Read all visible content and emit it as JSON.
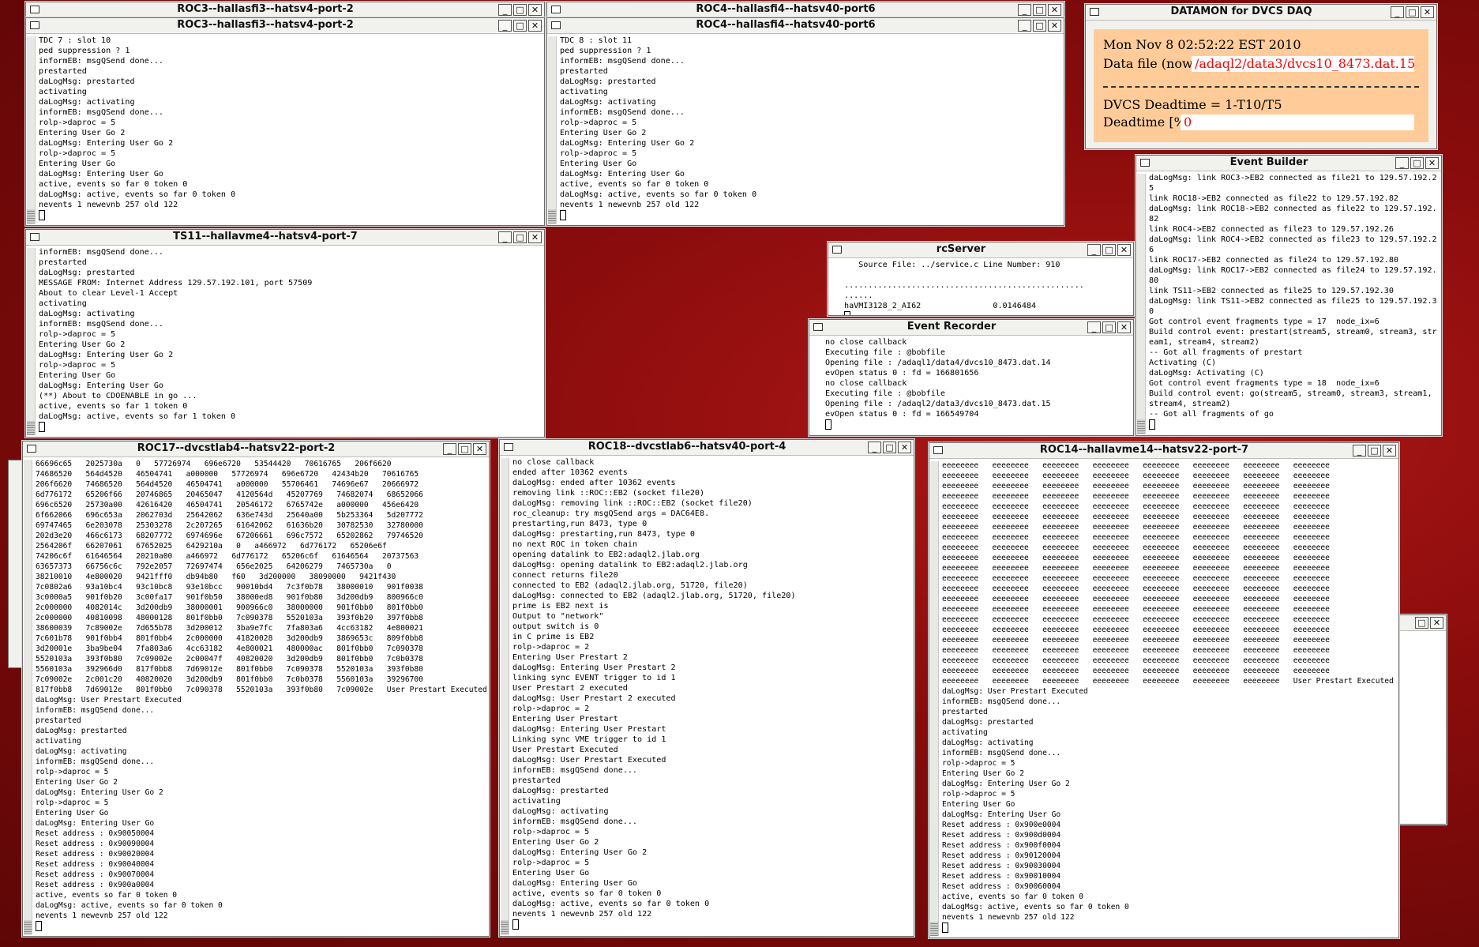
{
  "windows": {
    "roc3_back": {
      "title": "ROC3--hallasfi3--hatsv4-port-2"
    },
    "roc4_back": {
      "title": "ROC4--hallasfi4--hatsv40-port6"
    },
    "roc3": {
      "title": "ROC3--hallasfi3--hatsv4-port-2",
      "text": "TDC 7 : slot 10\nped suppression ? 1\ninformEB: msgQSend done...\nprestarted\ndaLogMsg: prestarted\nactivating\ndaLogMsg: activating\ninformEB: msgQSend done...\nrolp->daproc = 5\nEntering User Go 2\ndaLogMsg: Entering User Go 2\nrolp->daproc = 5\nEntering User Go\ndaLogMsg: Entering User Go\nactive, events so far 0 token 0\ndaLogMsg: active, events so far 0 token 0\nnevents 1 newevnb 257 old 122"
    },
    "roc4": {
      "title": "ROC4--hallasfi4--hatsv40-port6",
      "text": "TDC 8 : slot 11\nped suppression ? 1\ninformEB: msgQSend done...\nprestarted\ndaLogMsg: prestarted\nactivating\ndaLogMsg: activating\ninformEB: msgQSend done...\nrolp->daproc = 5\nEntering User Go 2\ndaLogMsg: Entering User Go 2\nrolp->daproc = 5\nEntering User Go\ndaLogMsg: Entering User Go\nactive, events so far 0 token 0\ndaLogMsg: active, events so far 0 token 0\nnevents 1 newevnb 257 old 122"
    },
    "ts11": {
      "title": "TS11--hallavme4--hatsv4-port-7",
      "text": "informEB: msgQSend done...\nprestarted\ndaLogMsg: prestarted\nMESSAGE FROM: Internet Address 129.57.192.101, port 57509\nAbout to clear Level-1 Accept\nactivating\ndaLogMsg: activating\ninformEB: msgQSend done...\nrolp->daproc = 5\nEntering User Go 2\ndaLogMsg: Entering User Go 2\nrolp->daproc = 5\nEntering User Go\ndaLogMsg: Entering User Go\n(**) About to CDOENABLE in go ...\nactive, events so far 1 token 0\ndaLogMsg: active, events so far 1 token 0"
    },
    "datamon": {
      "title": "DATAMON  for DVCS DAQ",
      "date": "Mon Nov  8 02:52:22 EST 2010",
      "datafile_label": "Data file (now)",
      "datafile_value": "/adaql2/data3/dvcs10_8473.dat.15",
      "deadtime_formula": "DVCS Deadtime = 1-T10/T5",
      "deadtime_label": "Deadtime [%]:",
      "deadtime_value": "0"
    },
    "event_builder": {
      "title": "Event Builder",
      "text": "daLogMsg: link ROC3->EB2 connected as file21 to 129.57.192.2\n5\nlink ROC18->EB2 connected as file22 to 129.57.192.82\ndaLogMsg: link ROC18->EB2 connected as file22 to 129.57.192.\n82\nlink ROC4->EB2 connected as file23 to 129.57.192.26\ndaLogMsg: link ROC4->EB2 connected as file23 to 129.57.192.2\n6\nlink ROC17->EB2 connected as file24 to 129.57.192.80\ndaLogMsg: link ROC17->EB2 connected as file24 to 129.57.192.\n80\nlink TS11->EB2 connected as file25 to 129.57.192.30\ndaLogMsg: link TS11->EB2 connected as file25 to 129.57.192.3\n0\nGot control event fragments type = 17  node_ix=6\nBuild control event: prestart(stream5, stream0, stream3, str\neam1, stream4, stream2)\n-- Got all fragments of prestart\nActivating (C)\ndaLogMsg: Activating (C)\nGot control event fragments type = 18  node_ix=6\nBuild control event: go(stream5, stream0, stream3, stream1,\nstream4, stream2)\n-- Got all fragments of go"
    },
    "rcserver": {
      "title": "rcServer",
      "text": "   Source File: ../service.c Line Number: 910\n\n..................................................\n......\nhaVMI3128_2_AI62               0.0146484"
    },
    "event_recorder": {
      "title": "Event Recorder",
      "text": "no close callback\nExecuting file : @bobfile\nOpening file : /adaql1/data4/dvcs10_8473.dat.14\nevOpen status 0 : fd = 166801656\nno close callback\nExecuting file : @bobfile\nOpening file : /adaql2/data3/dvcs10_8473.dat.15\nevOpen status 0 : fd = 166549704"
    },
    "roc17": {
      "title": "ROC17--dvcstlab4--hatsv22-port-2",
      "text": "66696c65   2025730a   0   57726974   696e6720   53544420   70616765   206f6620\n74686520   564d4520   46504741   a000000   57726974   696e6720   42434b20   70616765\n206f6620   74686520   564d4520   46504741   a000000   55706461   74696e67   20666972\n6d776172   65206f66   20746865   20465047   4120564d   45207769   74682074   68652066\n696c6520   25730a00   42616420   46504741   20546172   6765742e   a000000   456e6420\n6f662066   696c653a   2062703d   25642062   636e743d   25640a00   5b253364   5d207772\n69747465   6e203078   25303278   2c207265   61642062   61636b20   30782530   32780000\n202d3e20   466c6173   68207772   6974696e   67206661   696c7572   65202862   79746520\n2564206f   66207061   67652025   6429210a   0   a466972   6d776172   65206e6f\n74206c6f   61646564   20210a00   a466972   6d776172   65206c6f   61646564   20737563\n63657373   66756c6c   792e2057   72697474   656e2025   64206279   7465730a   0\n38210010   4e800020   9421fff0   db94b80   f60   3d200000   38090000   9421f430\n7c0802a6   93a10bc4   93c10bc8   93e10bcc   90010bd4   7c3f0b78   38000010   901f0038\n3c0000a5   901f0b20   3c00fa17   901f0b50   38000ed8   901f0b80   3d200db9   800966c0\n2c000000   4082014c   3d200db9   38000001   900966c0   38000000   901f0bb0   801f0bb0\n2c000000   40810098   48000128   801f0bb0   7c090378   5520103a   393f0b20   397f0bb8\n38600039   7c89002e   7d655b78   3d200012   3ba9e7fc   7fa803a6   4cc63182   4e800021\n7c601b78   901f0bb4   801f0bb4   2c000000   41820028   3d200db9   3869653c   809f0bb8\n3d20001e   3ba9be04   7fa803a6   4cc63182   4e800021   480000ac   801f0bb0   7c090378\n5520103a   393f0b80   7c09002e   2c00047f   40820020   3d200db9   801f0bb0   7c0b0378\n5560103a   392966d0   817f0bb8   7d69012e   801f0bb0   7c090378   5520103a   393f0b80\n7c09002e   2c001c20   40820020   3d200db9   801f0bb0   7c0b0378   5560103a   39296700\n817f0bb8   7d69012e   801f0bb0   7c090378   5520103a   393f0b80   7c09002e   User Prestart Executed\ndaLogMsg: User Prestart Executed\ninformEB: msgQSend done...\nprestarted\ndaLogMsg: prestarted\nactivating\ndaLogMsg: activating\ninformEB: msgQSend done...\nrolp->daproc = 5\nEntering User Go 2\ndaLogMsg: Entering User Go 2\nrolp->daproc = 5\nEntering User Go\ndaLogMsg: Entering User Go\nReset address : 0x90050004\nReset address : 0x90090004\nReset address : 0x90020004\nReset address : 0x90040004\nReset address : 0x90070004\nReset address : 0x900a0004\nactive, events so far 0 token 0\ndaLogMsg: active, events so far 0 token 0\nnevents 1 newevnb 257 old 122"
    },
    "roc18": {
      "title": "ROC18--dvcstlab6--hatsv40-port-4",
      "text": "no close callback\nended after 10362 events\ndaLogMsg: ended after 10362 events\nremoving link ::ROC::EB2 (socket file20)\ndaLogMsg: removing link ::ROC::EB2 (socket file20)\nroc_cleanup: try msgQSend args = DAC64E8.\nprestarting,run 8473, type 0\ndaLogMsg: prestarting,run 8473, type 0\nno next ROC in token chain\nopening datalink to EB2:adaql2.jlab.org\ndaLogMsg: opening datalink to EB2:adaql2.jlab.org\nconnect returns file20\nconnected to EB2 (adaql2.jlab.org, 51720, file20)\ndaLogMsg: connected to EB2 (adaql2.jlab.org, 51720, file20)\nprime is EB2 next is\nOutput to \"network\"\noutput switch is 0\nin C prime is EB2\nrolp->daproc = 2\nEntering User Prestart 2\ndaLogMsg: Entering User Prestart 2\nlinking sync EVENT trigger to id 1\nUser Prestart 2 executed\ndaLogMsg: User Prestart 2 executed\nrolp->daproc = 2\nEntering User Prestart\ndaLogMsg: Entering User Prestart\nLinking sync VME trigger to id 1\nUser Prestart Executed\ndaLogMsg: User Prestart Executed\ninformEB: msgQSend done...\nprestarted\ndaLogMsg: prestarted\nactivating\ndaLogMsg: activating\ninformEB: msgQSend done...\nrolp->daproc = 5\nEntering User Go 2\ndaLogMsg: Entering User Go 2\nrolp->daproc = 5\nEntering User Go\ndaLogMsg: Entering User Go\nactive, events so far 0 token 0\ndaLogMsg: active, events so far 0 token 0\nnevents 1 newevnb 257 old 122"
    },
    "roc14": {
      "title": "ROC14--hallavme14--hatsv22-port-7",
      "text": "eeeeeeee   eeeeeeee   eeeeeeee   eeeeeeee   eeeeeeee   eeeeeeee   eeeeeeee   eeeeeeee\neeeeeeee   eeeeeeee   eeeeeeee   eeeeeeee   eeeeeeee   eeeeeeee   eeeeeeee   eeeeeeee\neeeeeeee   eeeeeeee   eeeeeeee   eeeeeeee   eeeeeeee   eeeeeeee   eeeeeeee   eeeeeeee\neeeeeeee   eeeeeeee   eeeeeeee   eeeeeeee   eeeeeeee   eeeeeeee   eeeeeeee   eeeeeeee\neeeeeeee   eeeeeeee   eeeeeeee   eeeeeeee   eeeeeeee   eeeeeeee   eeeeeeee   eeeeeeee\neeeeeeee   eeeeeeee   eeeeeeee   eeeeeeee   eeeeeeee   eeeeeeee   eeeeeeee   eeeeeeee\neeeeeeee   eeeeeeee   eeeeeeee   eeeeeeee   eeeeeeee   eeeeeeee   eeeeeeee   eeeeeeee\neeeeeeee   eeeeeeee   eeeeeeee   eeeeeeee   eeeeeeee   eeeeeeee   eeeeeeee   eeeeeeee\neeeeeeee   eeeeeeee   eeeeeeee   eeeeeeee   eeeeeeee   eeeeeeee   eeeeeeee   eeeeeeee\neeeeeeee   eeeeeeee   eeeeeeee   eeeeeeee   eeeeeeee   eeeeeeee   eeeeeeee   eeeeeeee\neeeeeeee   eeeeeeee   eeeeeeee   eeeeeeee   eeeeeeee   eeeeeeee   eeeeeeee   eeeeeeee\neeeeeeee   eeeeeeee   eeeeeeee   eeeeeeee   eeeeeeee   eeeeeeee   eeeeeeee   eeeeeeee\neeeeeeee   eeeeeeee   eeeeeeee   eeeeeeee   eeeeeeee   eeeeeeee   eeeeeeee   eeeeeeee\neeeeeeee   eeeeeeee   eeeeeeee   eeeeeeee   eeeeeeee   eeeeeeee   eeeeeeee   eeeeeeee\neeeeeeee   eeeeeeee   eeeeeeee   eeeeeeee   eeeeeeee   eeeeeeee   eeeeeeee   eeeeeeee\neeeeeeee   eeeeeeee   eeeeeeee   eeeeeeee   eeeeeeee   eeeeeeee   eeeeeeee   eeeeeeee\neeeeeeee   eeeeeeee   eeeeeeee   eeeeeeee   eeeeeeee   eeeeeeee   eeeeeeee   eeeeeeee\neeeeeeee   eeeeeeee   eeeeeeee   eeeeeeee   eeeeeeee   eeeeeeee   eeeeeeee   eeeeeeee\neeeeeeee   eeeeeeee   eeeeeeee   eeeeeeee   eeeeeeee   eeeeeeee   eeeeeeee   eeeeeeee\neeeeeeee   eeeeeeee   eeeeeeee   eeeeeeee   eeeeeeee   eeeeeeee   eeeeeeee   eeeeeeee\neeeeeeee   eeeeeeee   eeeeeeee   eeeeeeee   eeeeeeee   eeeeeeee   eeeeeeee   eeeeeeee\neeeeeeee   eeeeeeee   eeeeeeee   eeeeeeee   eeeeeeee   eeeeeeee   eeeeeeee   User Prestart Executed\ndaLogMsg: User Prestart Executed\ninformEB: msgQSend done...\nprestarted\ndaLogMsg: prestarted\nactivating\ndaLogMsg: activating\ninformEB: msgQSend done...\nrolp->daproc = 5\nEntering User Go 2\ndaLogMsg: Entering User Go 2\nrolp->daproc = 5\nEntering User Go\ndaLogMsg: Entering User Go\nReset address : 0x900e0004\nReset address : 0x900d0004\nReset address : 0x900f0004\nReset address : 0x90120004\nReset address : 0x90030004\nReset address : 0x90010004\nReset address : 0x90060004\nactive, events so far 0 token 0\ndaLogMsg: active, events so far 0 token 0\nnevents 1 newevnb 257 old 122"
    }
  },
  "buttons": {
    "minimize": "_",
    "maximize": "□",
    "close": "✕"
  },
  "colors": {
    "desktop": "#8a0c0c",
    "datamon_panel": "#ffcc99",
    "datamon_value": "#ff0000"
  }
}
